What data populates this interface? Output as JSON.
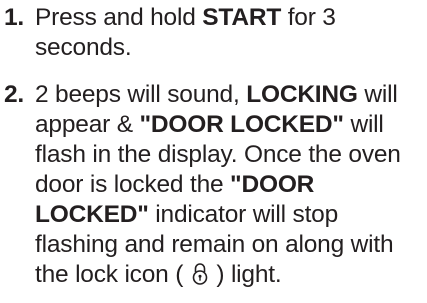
{
  "steps": [
    {
      "number": "1.",
      "lines": [
        {
          "a": "Press and hold ",
          "b": "START",
          "c": " for 3"
        },
        {
          "a": "seconds."
        }
      ]
    },
    {
      "number": "2.",
      "lines": [
        {
          "a": "2 beeps will sound, ",
          "b": "LOCKING",
          "c": " will"
        },
        {
          "a": "appear & ",
          "b": "\"DOOR LOCKED\"",
          "c": " will"
        },
        {
          "a": "flash in the display. Once the oven"
        },
        {
          "a": "door is locked the ",
          "b": "\"DOOR"
        },
        {
          "a": "LOCKED\"",
          "c": " indicator will stop"
        },
        {
          "a": "flashing and remain on along with"
        },
        {
          "a": "the lock icon ( ",
          "c": " ) light."
        }
      ]
    }
  ],
  "icons": {
    "lock": "lock-icon"
  }
}
